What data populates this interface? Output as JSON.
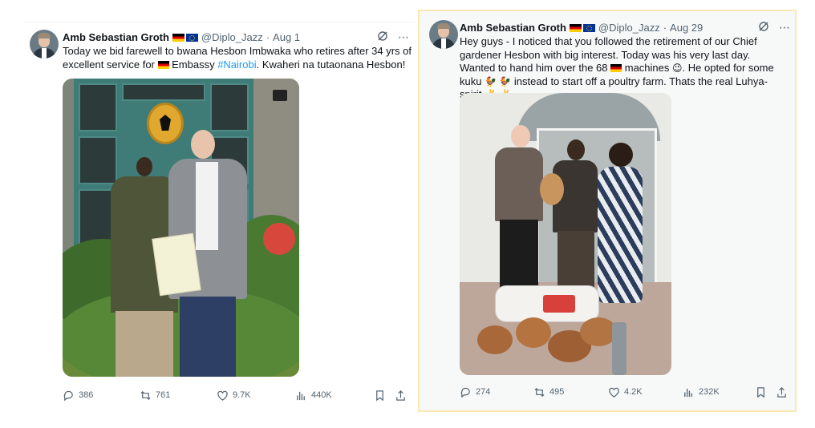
{
  "tweets": [
    {
      "author": "Amb Sebastian Groth",
      "flags": [
        "germany-flag",
        "eu-flag"
      ],
      "handle": "@Diplo_Jazz",
      "separator": "·",
      "date": "Aug 1",
      "text_parts": {
        "p1": "Today we bid farewell to bwana Hesbon Imbwaka who retires after 34 yrs of excellent service for ",
        "p2": " Embassy ",
        "hashtag": "#Nairobi",
        "p3": ". Kwaheri na tutaonana Hesbon!"
      },
      "stats": {
        "replies": "386",
        "retweets": "761",
        "likes": "9.7K",
        "views": "440K"
      }
    },
    {
      "author": "Amb Sebastian Groth",
      "flags": [
        "germany-flag",
        "eu-flag"
      ],
      "handle": "@Diplo_Jazz",
      "separator": "·",
      "date": "Aug 29",
      "text_parts": {
        "p1": "Hey guys - I noticed that you followed the retirement of our Chief gardener Hesbon with big interest. Today was his very last day. Wanted to hand him over the 68 ",
        "p2": " machines ",
        "emoji1": "😉",
        "p3": ". He opted for some kuku ",
        "emoji2": "🐓 🐓",
        "p4": " instead to start off a poultry farm. Thats the real Luhya-spirit ",
        "emoji3": "✌️ ✌️",
        "p5": "."
      },
      "stats": {
        "replies": "274",
        "retweets": "495",
        "likes": "4.2K",
        "views": "232K"
      }
    }
  ],
  "colors": {
    "hashtag": "#1d9bf0",
    "muted": "#536471",
    "highlight_border": "#fbe7b0"
  }
}
